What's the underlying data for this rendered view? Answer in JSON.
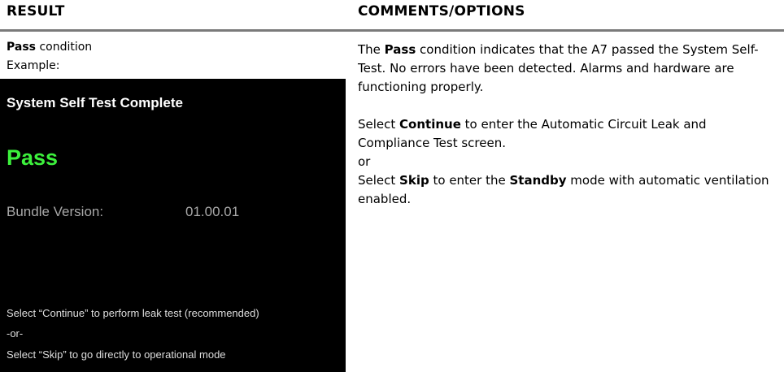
{
  "headers": {
    "result": "RESULT",
    "comments": "COMMENTS/OPTIONS"
  },
  "left": {
    "pass_bold": "Pass",
    "pass_rest": " condition",
    "example": "Example:"
  },
  "screen": {
    "title": "System Self Test Complete",
    "status": "Pass",
    "bundle_label": "Bundle Version:",
    "bundle_value": "01.00.01",
    "instr1": "Select “Continue” to perform leak test (recommended)",
    "instr2": "-or-",
    "instr3": "Select “Skip” to go directly to operational mode"
  },
  "right": {
    "p1_a": "The ",
    "p1_b": "Pass",
    "p1_c": " condition indicates that the A7 passed the System Self-Test. No errors have been detected. Alarms and hardware are functioning properly.",
    "p2_a": "Select ",
    "p2_b": "Continue",
    "p2_c": " to enter the Automatic Circuit Leak and Compliance Test screen.",
    "p3": "or",
    "p4_a": "Select ",
    "p4_b": "Skip",
    "p4_c": " to enter the ",
    "p4_d": "Standby",
    "p4_e": " mode with automatic ventilation enabled."
  }
}
